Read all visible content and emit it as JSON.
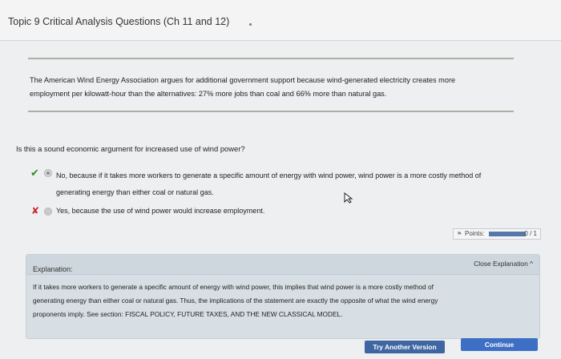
{
  "header": {
    "title": "Topic 9 Critical Analysis Questions (Ch 11 and 12)"
  },
  "passage": {
    "line1": "The American Wind Energy Association argues for additional government support because wind-generated electricity creates more",
    "line2": "employment per kilowatt-hour than the alternatives: 27% more jobs than coal and 66% more than natural gas."
  },
  "question": "Is this a sound economic argument for increased use of wind power?",
  "options": [
    {
      "mark": "✔",
      "line1": "No, because if it takes more workers to generate a specific amount of energy with wind power, wind power is a more costly method of",
      "line2": "generating energy than either coal or natural gas.",
      "selected": true
    },
    {
      "mark": "✘",
      "line1": "Yes, because the use of wind power would increase employment.",
      "selected": false
    }
  ],
  "points": {
    "label": "Points:",
    "score": "0 / 1",
    "fill_fraction": 0.0
  },
  "explanation": {
    "label": "Explanation:",
    "close_label": "Close Explanation",
    "line1": "If it takes more workers to generate a specific amount of energy with wind power, this implies that wind power is a more costly method of",
    "line2": "generating energy than either coal or natural gas. Thus, the implications of the statement are exactly the opposite of what the wind energy",
    "line3": "proponents imply. See section: FISCAL POLICY, FUTURE TAXES, AND THE NEW CLASSICAL MODEL."
  },
  "buttons": {
    "try_another": "Try Another Version",
    "continue": "Continue"
  },
  "colors": {
    "correct": "#2e8b2e",
    "incorrect": "#c62828",
    "button": "#3d6fc4"
  }
}
